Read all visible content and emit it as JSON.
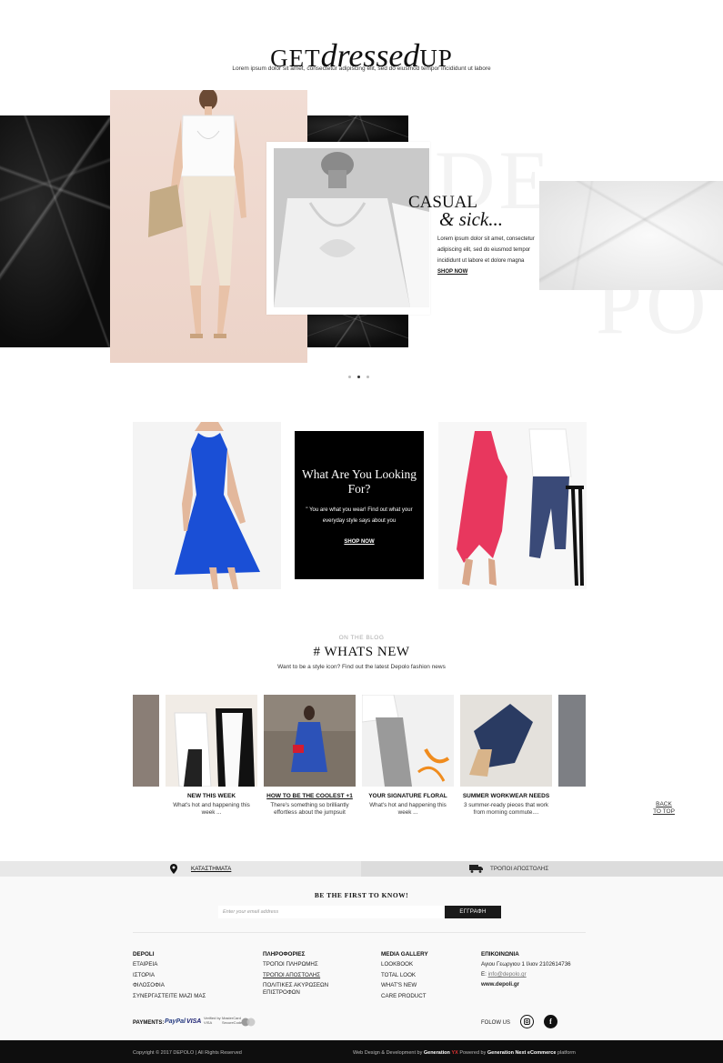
{
  "hero": {
    "title_pre": "GET",
    "title_script": "dressed",
    "title_post": "UP",
    "subtitle": "Lorem ipsum dolor sit amet, consectetur adipiscing elit, sed do eiusmod tempor incididunt ut labore",
    "ghost_word_top": "DE",
    "ghost_word_bottom": "PO",
    "casual_line1": "CASUAL",
    "casual_line2": "& sick...",
    "casual_text": "Lorem ipsum dolor sit amet, consectetur adipiscing elit, sed do eiusmod tempor incididunt ut labore et dolore magna",
    "shop_label": "SHOP NOW",
    "slider_active_index": 2,
    "slider_count": 3
  },
  "promo": {
    "title": "What Are You Looking For?",
    "text": "\" You are what you wear! Find out what your everyday style says about you",
    "shop_label": "SHOP NOW"
  },
  "blog": {
    "eyebrow": "ON THE BLOG",
    "title": "# WHATS NEW",
    "subtitle": "Want to be a style icon? Find out the latest Depolo fashion news",
    "posts": [
      {
        "title": "NEW THIS WEEK",
        "desc": "What's hot and happening this week ...",
        "linked": false
      },
      {
        "title": "HOW TO BE THE COOLEST +1",
        "desc": "There's something so brilliantly effortless about the jumpsuit",
        "linked": true
      },
      {
        "title": "YOUR SIGNATURE FLORAL",
        "desc": "What's hot and happening this week ...",
        "linked": false
      },
      {
        "title": "SUMMER WORKWEAR NEEDS",
        "desc": "3 summer-ready pieces that work from morning commute....",
        "linked": false
      }
    ],
    "back_to_top": "BACK TO TOP"
  },
  "service_bar": {
    "stores_label": "ΚΑΤΑΣΤΗΜΑΤΑ",
    "stores_icon": "map-pin-icon",
    "shipping_label": "ΤΡΟΠΟΙ ΑΠΟΣΤΟΛΗΣ",
    "shipping_icon": "truck-icon"
  },
  "newsletter": {
    "title": "BE THE FIRST TO KNOW!",
    "placeholder": "Enter your email address",
    "button": "ΕΓΓΡΑΦΗ"
  },
  "footer": {
    "columns": [
      {
        "heading": "DEPOLI",
        "links": [
          "ΕΤΑΙΡΕΙΑ",
          "ΙΣΤΟΡΙΑ",
          "ΦΙΛΟΣΟΦΙΑ",
          "ΣΥΝΕΡΓΑΣΤΕΙΤΕ ΜΑΖΙ ΜΑΣ"
        ]
      },
      {
        "heading": "ΠΛΗΡΟΦΟΡΙΕΣ",
        "links": [
          "ΤΡΟΠΟΙ ΠΛΗΡΩΜΗΣ",
          "ΤΡΟΠΟΙ ΑΠΟΣΤΟΛΗΣ",
          "ΠΟΛΙΤΙΚΕΣ ΑΚΥΡΩΣΕΩΝ ΕΠΙΣΤΡΟΦΩΝ"
        ]
      },
      {
        "heading": "MEDIA GALLERY",
        "links": [
          "LOOKBOOK",
          "TOTAL LOOK",
          "WHAT'S NEW",
          "CARE PRODUCT"
        ]
      },
      {
        "heading": "ΕΠΙΚΟΙΝΩΝΙΑ",
        "address": "Αγιου Γεωργιου 1 Ιλιον 2102614736",
        "email_prefix": "E:",
        "email": "info@depolo.gr",
        "website": "www.depoli.gr"
      }
    ],
    "payments_label": "PAYMENTS:",
    "payment_logos": {
      "paypal": "PayPal",
      "visa": "VISA",
      "verified_by_visa": "Verified by VISA",
      "mastercard_securecode": "MasterCard SecureCode"
    },
    "follow_label": "FOLOW US",
    "social": [
      {
        "name": "instagram-icon"
      },
      {
        "name": "facebook-icon",
        "glyph": "f"
      }
    ]
  },
  "bottom_bar": {
    "copyright": "Copyright © 2017 DEPOLO | All Rights Reserved",
    "credits_prefix": "Web Design & Development by",
    "credits_company": "Generation",
    "credits_mark": "YX",
    "credits_middle": "Powered by",
    "credits_platform": "Generation Next eCommerce",
    "credits_suffix": "platform"
  },
  "colors": {
    "accent": "#111111",
    "page_background": "#ffffff",
    "footer_background": "#f9f9f9",
    "bottom_bar": "#0e0e0e",
    "blush": "#ecd3c8",
    "cobalt_dress": "#1a4fd6",
    "pink_dress": "#e8375e"
  }
}
